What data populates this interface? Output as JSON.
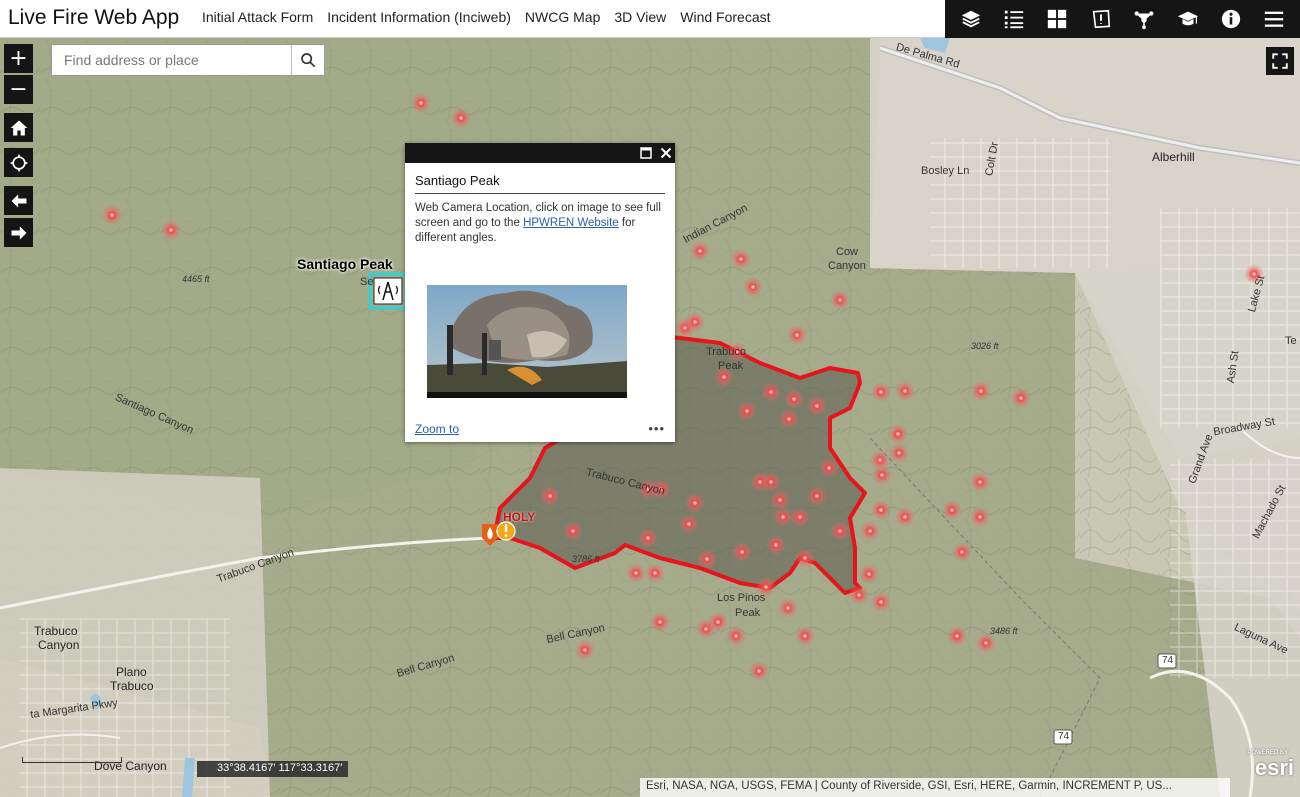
{
  "header": {
    "title": "Live Fire Web App",
    "nav": [
      {
        "label": "Initial Attack Form"
      },
      {
        "label": "Incident Information (Inciweb)"
      },
      {
        "label": "NWCG Map"
      },
      {
        "label": "3D View"
      },
      {
        "label": "Wind Forecast"
      }
    ],
    "toolbar_icons": [
      "layers-icon",
      "legend-icon",
      "basemap-gallery-icon",
      "print-icon",
      "share-icon",
      "education-icon",
      "info-icon",
      "menu-icon"
    ]
  },
  "search": {
    "placeholder": "Find address or place"
  },
  "controls": {
    "zoom_in": "+",
    "zoom_out": "−"
  },
  "popup": {
    "title": "Santiago Peak",
    "body_before": "Web Camera Location, click on image to see full screen and go to the ",
    "link": "HPWREN Website",
    "body_after": " for different angles.",
    "zoom_to": "Zoom to",
    "more": "•••"
  },
  "map": {
    "peak_label": "Santiago Peak",
    "fire_label": "HOLY",
    "labels": {
      "de_palma": "De Palma Rd",
      "alberhill": "Alberhill",
      "bosley": "Bosley Ln",
      "colt": "Colt Dr",
      "indian": "Indian Canyon",
      "cow": "Cow",
      "cow2": "Canyon",
      "lake": "Lake St",
      "elev4465": "4465 ft",
      "elev3026": "3026 ft",
      "elev3486": "3486 ft",
      "elev3786": "3786 ft",
      "trabuco_peak": "Trabuco",
      "trabuco_peak2": "Peak",
      "santiago_canyon": "Santiago Canyon",
      "trabuco_canyon_mid": "Trabuco Canyon",
      "trabuco_canyon_left": "Trabuco Canyon",
      "broadway": "Broadway St",
      "grand": "Grand Ave",
      "ash": "Ash St",
      "machado": "Machado St",
      "los_pinos": "Los Pinos",
      "los_pinos2": "Peak",
      "bell_canyon_mid": "Bell Canyon",
      "bell_canyon_low": "Bell Canyon",
      "trabuco_town": "Trabuco",
      "trabuco_town2": "Canyon",
      "plano": "Plano",
      "plano2": "Trabuco",
      "laguna": "Laguna Ave",
      "route74a": "74",
      "route74b": "74",
      "margarita": "ta Margarita Pkwy",
      "dove": "Dove Canyon",
      "te": "Te",
      "se": "Se"
    },
    "coords": "33°38.4167′ 117°33.3167′",
    "attribution": "Esri, NASA, NGA, USGS, FEMA | County of Riverside, GSI, Esri, HERE, Garmin, INCREMENT P, US...",
    "esri_powered": "POWERED BY",
    "esri": "esri"
  },
  "colors": {
    "fire_perimeter": "#e8141c",
    "hotspot": "#f04848",
    "toolbar": "#151515"
  }
}
